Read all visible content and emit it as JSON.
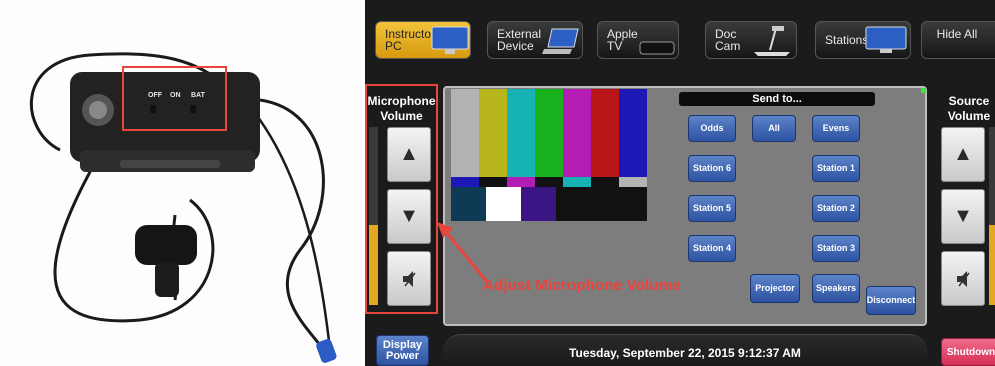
{
  "device": {
    "switch_labels": [
      "OFF",
      "ON",
      "BAT"
    ]
  },
  "top_buttons": [
    {
      "label": "Instructor PC",
      "icon": "monitor-icon",
      "active": true
    },
    {
      "label": "External Device",
      "icon": "laptop-icon",
      "active": false
    },
    {
      "label": "Apple TV",
      "icon": "appletv-icon",
      "active": false
    },
    {
      "label": "Doc Cam",
      "icon": "document-camera-icon",
      "active": false
    },
    {
      "label": "Stations",
      "icon": "monitor-icon",
      "active": false
    },
    {
      "label": "Hide All",
      "icon": "",
      "active": false
    }
  ],
  "mic_panel": {
    "title": "Microphone Volume",
    "level": 0.45
  },
  "source_panel": {
    "title": "Source Volume",
    "level": 0.45
  },
  "send_to": {
    "title": "Send to...",
    "buttons": {
      "odds": "Odds",
      "all": "All",
      "evens": "Evens",
      "station6": "Station 6",
      "station1": "Station 1",
      "station5": "Station 5",
      "station2": "Station 2",
      "station4": "Station 4",
      "station3": "Station 3",
      "projector": "Projector",
      "speakers": "Speakers",
      "disconnect": "Disconnect"
    }
  },
  "annotation": {
    "text": "Adjust Microphone Volume",
    "color": "#f0413a"
  },
  "footer": {
    "display_power": "Display Power",
    "datetime": "Tuesday, September 22, 2015 9:12:37 AM",
    "shutdown": "Shutdown"
  },
  "colors": {
    "active_button": "#e8b32a",
    "blue_button": "#3d63b1",
    "shutdown_button": "#e0456a",
    "volume_fill": "#e5a622"
  }
}
